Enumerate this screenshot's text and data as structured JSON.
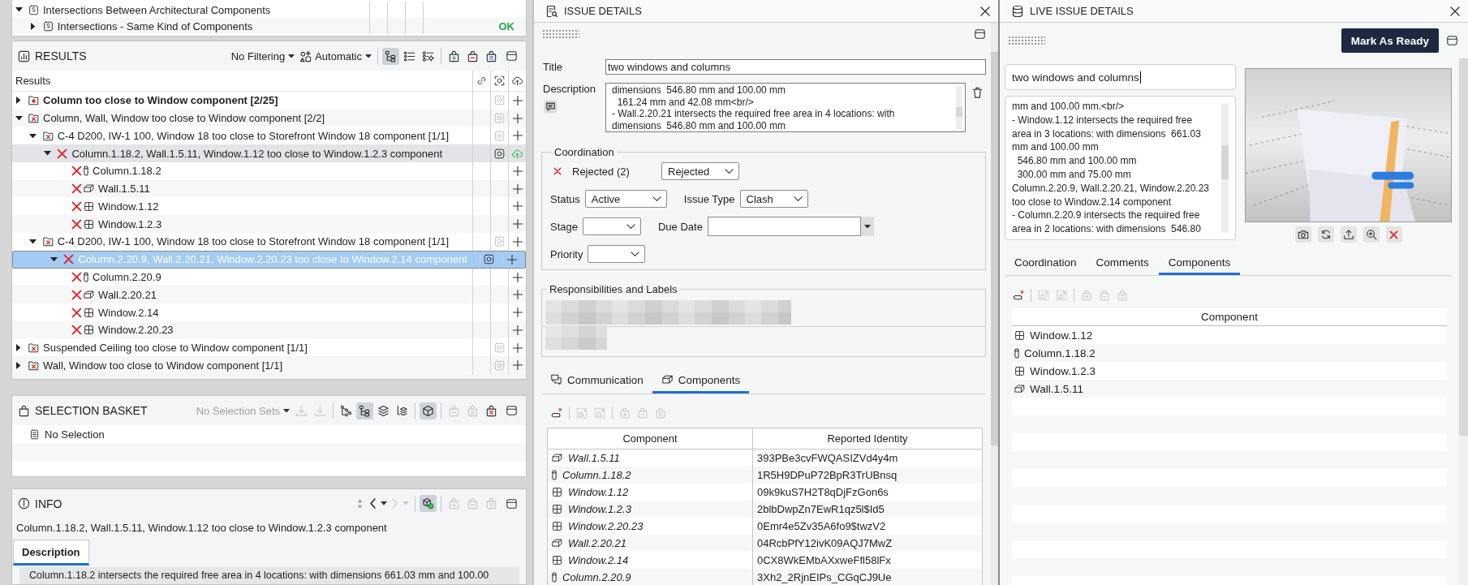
{
  "checks": {
    "rows": [
      {
        "label": "Intersections Between Architectural Components",
        "expanded": true,
        "children": [
          {
            "label": "Intersections - Same Kind of Components",
            "expanded": false,
            "result": "OK"
          }
        ]
      }
    ]
  },
  "results": {
    "title": "RESULTS",
    "filter": "No Filtering",
    "mode": "Automatic",
    "view_modes": [
      {
        "kind": "tree",
        "selected": true
      },
      {
        "kind": "list",
        "selected": false
      },
      {
        "kind": "grouped",
        "selected": false
      }
    ],
    "basket_actions": [
      {
        "kind": "add",
        "disabled": false
      },
      {
        "kind": "remove",
        "disabled": false
      },
      {
        "kind": "show",
        "disabled": false
      }
    ],
    "column": "Results",
    "rows": [
      {
        "label": "Column too close to Window component [2/25]",
        "kind": "group",
        "new": true,
        "expanded": false,
        "selected": false,
        "hovered": false
      },
      {
        "label": "Column, Wall, Window too close to Window component [2/2]",
        "kind": "group",
        "new": false,
        "expanded": true,
        "selected": false,
        "hovered": false,
        "children": [
          {
            "label": "C-4 D200, IW-1 100, Window 18 too close to Storefront Window 18 component [1/1]",
            "kind": "group",
            "new": false,
            "expanded": true,
            "selected": false,
            "hovered": false,
            "children": [
              {
                "label": "Column.1.18.2, Wall.1.5.11, Window.1.12 too close to Window.1.2.3 component",
                "kind": "issue",
                "expanded": true,
                "selected": false,
                "hovered": true,
                "children": [
                  {
                    "label": "Column.1.18.2",
                    "kind": "column",
                    "selected": false,
                    "hovered": false
                  },
                  {
                    "label": "Wall.1.5.11",
                    "kind": "wall",
                    "selected": false,
                    "hovered": false
                  },
                  {
                    "label": "Window.1.12",
                    "kind": "window",
                    "selected": false,
                    "hovered": false
                  },
                  {
                    "label": "Window.1.2.3",
                    "kind": "window",
                    "selected": false,
                    "hovered": false
                  }
                ]
              }
            ]
          },
          {
            "label": "C-4 D200, IW-1 100, Window 18 too close to Storefront Window 18 component [1/1]",
            "kind": "group",
            "new": false,
            "expanded": true,
            "selected": false,
            "hovered": false,
            "children": [
              {
                "label": "Column.2.20.9, Wall.2.20.21, Window.2.20.23 too close to Window.2.14 component",
                "kind": "issue",
                "expanded": true,
                "selected": true,
                "hovered": false,
                "children": [
                  {
                    "label": "Column.2.20.9",
                    "kind": "column",
                    "selected": false,
                    "hovered": false
                  },
                  {
                    "label": "Wall.2.20.21",
                    "kind": "wall",
                    "selected": false,
                    "hovered": false
                  },
                  {
                    "label": "Window.2.14",
                    "kind": "window",
                    "selected": false,
                    "hovered": false
                  },
                  {
                    "label": "Window.2.20.23",
                    "kind": "window",
                    "selected": false,
                    "hovered": false
                  }
                ]
              }
            ]
          }
        ]
      },
      {
        "label": "Suspended Ceiling too close to Window component [1/1]",
        "kind": "group",
        "new": false,
        "expanded": false,
        "selected": false,
        "hovered": false
      },
      {
        "label": "Wall, Window too close to Window component [1/1]",
        "kind": "group",
        "new": false,
        "expanded": false,
        "selected": false,
        "hovered": false
      }
    ]
  },
  "basket": {
    "title": "SELECTION BASKET",
    "sets": {
      "label": "No Selection Sets",
      "disabled": true
    },
    "imports": [
      {
        "kind": "load",
        "disabled": true
      },
      {
        "kind": "loadall",
        "disabled": true
      }
    ],
    "view_modes": [
      {
        "kind": "hierarchy",
        "selected": false
      },
      {
        "kind": "tree",
        "selected": true
      },
      {
        "kind": "layers",
        "selected": false
      },
      {
        "kind": "layertree",
        "selected": false
      }
    ],
    "display_toggle": {
      "on": true
    },
    "basket_actions": [
      {
        "kind": "remove",
        "disabled": true
      },
      {
        "kind": "show",
        "disabled": true
      },
      {
        "kind": "clear",
        "disabled": false
      }
    ],
    "items": [
      "No Selection"
    ]
  },
  "info": {
    "title": "INFO",
    "history": [
      {
        "kind": "back",
        "disabled": false
      },
      {
        "kind": "forward",
        "disabled": true
      }
    ],
    "selection_toggle": {
      "on": true
    },
    "basket_actions": [
      {
        "kind": "add",
        "disabled": true
      },
      {
        "kind": "remove",
        "disabled": true
      },
      {
        "kind": "show",
        "disabled": true
      }
    ],
    "heading": "Column.1.18.2, Wall.1.5.11, Window.1.12 too close to Window.1.2.3 component",
    "tabs": [
      {
        "label": "Description",
        "selected": true
      }
    ],
    "description": "Column.1.18.2 intersects the required free area in 4 locations: with dimensions 661.03 mm and 100.00"
  },
  "issue_details": {
    "title": "ISSUE DETAILS",
    "title_label": "Title",
    "title_value": "two windows and columns",
    "description_label": "Description",
    "description": "dimensions  546.80 mm and 100.00 mm\n  161.24 mm and 42.08 mm<br/>\n- Wall.2.20.21 intersects the required free area in 4 locations: with\ndimensions  546.80 mm and 100.00 mm",
    "coordination": {
      "legend": "Coordination",
      "decision": "Rejected (2)",
      "decision_value": "Rejected",
      "rows": [
        [
          {
            "label": "Status",
            "kind": "select",
            "value": "Active"
          },
          {
            "label": "Issue Type",
            "kind": "select",
            "value": "Clash"
          }
        ],
        [
          {
            "label": "Stage",
            "kind": "select"
          },
          {
            "label": "Due Date",
            "kind": "date"
          }
        ],
        [
          {
            "label": "Priority",
            "kind": "select"
          }
        ]
      ]
    },
    "responsibilities": {
      "legend": "Responsibilities and Labels"
    },
    "tabs": [
      {
        "label": "Communication",
        "kind": "chat",
        "selected": false
      },
      {
        "label": "Components",
        "kind": "components",
        "selected": true
      }
    ],
    "toolbar": [
      {
        "kind": "detach",
        "disabled": false
      },
      {
        "kind": "mark",
        "disabled": true
      },
      {
        "kind": "unmark",
        "disabled": true
      },
      {
        "kind": "add",
        "disabled": true
      },
      {
        "kind": "remove",
        "disabled": true
      },
      {
        "kind": "show",
        "disabled": true
      }
    ],
    "table": {
      "columns": [
        "Component",
        "Reported Identity"
      ],
      "rows": [
        {
          "name": "Wall.1.5.11",
          "kind": "wall",
          "identity": "393PBe3cvFWQASIZVd4y4m"
        },
        {
          "name": "Column.1.18.2",
          "kind": "column",
          "identity": "1R5H9DPuP72BpR3TrUBnsq"
        },
        {
          "name": "Window.1.12",
          "kind": "window",
          "identity": "09k9kuS7H2T8qDjFzGon6s"
        },
        {
          "name": "Window.1.2.3",
          "kind": "window",
          "identity": "2blbDwpZn7EwR1qz5l$Id5"
        },
        {
          "name": "Window.2.20.23",
          "kind": "window",
          "identity": "0Emr4e5Zv35A6fo9$twzV2"
        },
        {
          "name": "Wall.2.20.21",
          "kind": "wall",
          "identity": "04RcbPfY12ivK09AQJ7MwZ"
        },
        {
          "name": "Window.2.14",
          "kind": "window",
          "identity": "0CX8WkEMbAXxweFfl58lFx"
        },
        {
          "name": "Column.2.20.9",
          "kind": "column",
          "identity": "3Xh2_2RjnEIPs_CGqCJ9Ue"
        }
      ]
    }
  },
  "live_issue": {
    "title": "LIVE ISSUE DETAILS",
    "action": "Mark As Ready",
    "title_value": "two windows and columns",
    "focused": true,
    "description": "mm and 100.00 mm.<br/>\n- Window.1.12 intersects the required free\narea in 3 locations: with dimensions  661.03\nmm and 100.00 mm\n  546.80 mm and 100.00 mm\n  300.00 mm and 75.00 mm\nColumn.2.20.9, Wall.2.20.21, Window.2.20.23\ntoo close to Window.2.14 component\n- Column.2.20.9 intersects the required free\narea in 2 locations: with dimensions  546.80",
    "tabs": [
      {
        "label": "Coordination",
        "selected": false
      },
      {
        "label": "Comments",
        "selected": false
      },
      {
        "label": "Components",
        "selected": true
      }
    ],
    "toolbar": [
      {
        "kind": "detach",
        "disabled": false
      },
      {
        "kind": "mark",
        "disabled": true
      },
      {
        "kind": "unmark",
        "disabled": true
      },
      {
        "kind": "add",
        "disabled": true
      },
      {
        "kind": "remove",
        "disabled": true
      },
      {
        "kind": "show",
        "disabled": true
      }
    ],
    "table": {
      "columns": [
        "Component"
      ],
      "rows": [
        {
          "name": "Window.1.12",
          "kind": "window"
        },
        {
          "name": "Column.1.18.2",
          "kind": "column"
        },
        {
          "name": "Window.1.2.3",
          "kind": "window"
        },
        {
          "name": "Wall.1.5.11",
          "kind": "wall"
        }
      ]
    }
  }
}
